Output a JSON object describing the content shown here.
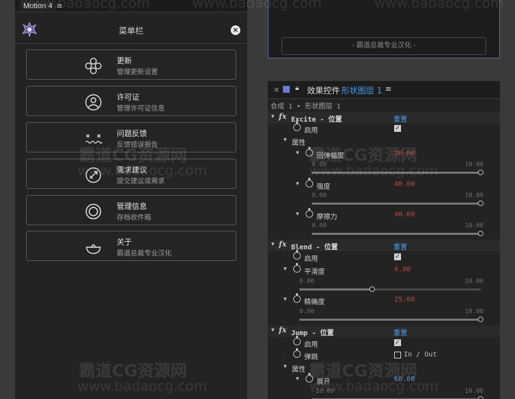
{
  "left": {
    "tab_label": "Motion 4",
    "tab_menu_icon": "hamburger-icon",
    "header_title": "菜单栏",
    "close_icon": "close-icon",
    "items": [
      {
        "title": "更新",
        "subtitle": "管理更新设置",
        "icon": "update-icon"
      },
      {
        "title": "许可证",
        "subtitle": "管理许可证信息",
        "icon": "license-icon"
      },
      {
        "title": "问题反馈",
        "subtitle": "反馈错误报告",
        "icon": "feedback-icon"
      },
      {
        "title": "需求建议",
        "subtitle": "提交建议或需求",
        "icon": "suggestion-icon"
      },
      {
        "title": "管理信息",
        "subtitle": "存档收件箱",
        "icon": "archive-icon"
      },
      {
        "title": "关于",
        "subtitle": "霸道总裁专业汉化",
        "icon": "about-icon"
      }
    ]
  },
  "right_top": {
    "footer_text": "- 霸道总裁专业汉化 -"
  },
  "effects": {
    "close_label": "×",
    "lock_icon": "lock-icon",
    "panel_title": "效果控件",
    "layer_name": "形状图层 1",
    "menu_label": "≡",
    "breadcrumb": "合成 1 • 形状图层 1",
    "reset_label": "重置",
    "fx_label": "fx",
    "groups": [
      {
        "name": "Excite - 位置",
        "enable_label": "启用",
        "props_label": "属性",
        "params": [
          {
            "label": "回弹幅度",
            "value": "20.00",
            "min": "0.00",
            "max": "10.00",
            "level": 1.0
          },
          {
            "label": "强度",
            "value": "40.00",
            "min": "0.00",
            "max": "10.00",
            "level": 1.0
          },
          {
            "label": "摩擦力",
            "value": "40.00",
            "min": "0.00",
            "max": "10.00",
            "level": 1.0
          }
        ]
      },
      {
        "name": "Blend - 位置",
        "enable_label": "启用",
        "params": [
          {
            "label": "平滑度",
            "value": "4.00",
            "min": "0.00",
            "max": "10.00",
            "level": 0.4
          },
          {
            "label": "精确度",
            "value": "25.00",
            "min": "0.00",
            "max": "10.00",
            "level": 1.0
          }
        ]
      },
      {
        "name": "Jump - 位置",
        "enable_label": "启用",
        "bounce_label": "弹跳",
        "bounce_option": "In / Out",
        "props_label": "属性",
        "params": [
          {
            "label": "展开",
            "value": "60.00",
            "min": "-10.00",
            "max": "10.00",
            "level": 1.0
          }
        ]
      }
    ]
  },
  "watermark": {
    "brand": "霸道CG资源网",
    "url": "www.badaocg.com"
  },
  "colors": {
    "accent_blue": "#4a9be8",
    "value_red": "#d83a3a",
    "panel_bg": "#232323"
  }
}
